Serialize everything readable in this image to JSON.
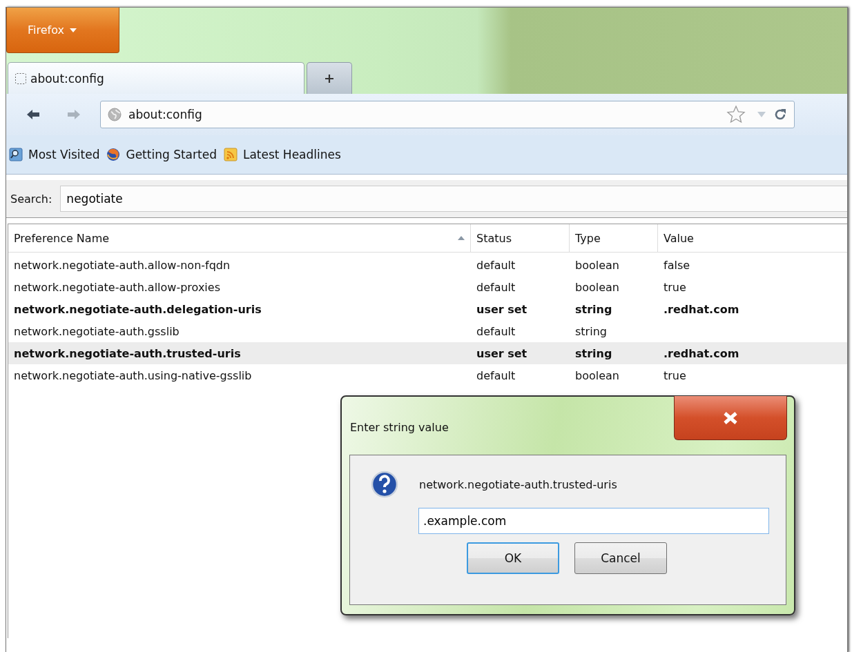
{
  "app_button": {
    "label": "Firefox"
  },
  "tabs": [
    {
      "title": "about:config",
      "selected": true
    }
  ],
  "address_bar": {
    "value": "about:config"
  },
  "bookmarks": [
    {
      "label": "Most Visited",
      "kind": "search"
    },
    {
      "label": "Getting Started",
      "kind": "globe"
    },
    {
      "label": "Latest Headlines",
      "kind": "feed"
    }
  ],
  "search": {
    "label": "Search:",
    "value": "negotiate"
  },
  "table": {
    "columns": [
      {
        "label": "Preference Name",
        "sorted": true
      },
      {
        "label": "Status",
        "sorted": false
      },
      {
        "label": "Type",
        "sorted": false
      },
      {
        "label": "Value",
        "sorted": false
      }
    ],
    "rows": [
      {
        "name": "network.negotiate-auth.allow-non-fqdn",
        "status": "default",
        "type": "boolean",
        "value": "false",
        "modified": false,
        "selected": false
      },
      {
        "name": "network.negotiate-auth.allow-proxies",
        "status": "default",
        "type": "boolean",
        "value": "true",
        "modified": false,
        "selected": false
      },
      {
        "name": "network.negotiate-auth.delegation-uris",
        "status": "user set",
        "type": "string",
        "value": ".redhat.com",
        "modified": true,
        "selected": false
      },
      {
        "name": "network.negotiate-auth.gsslib",
        "status": "default",
        "type": "string",
        "value": "",
        "modified": false,
        "selected": false
      },
      {
        "name": "network.negotiate-auth.trusted-uris",
        "status": "user set",
        "type": "string",
        "value": ".redhat.com",
        "modified": true,
        "selected": true
      },
      {
        "name": "network.negotiate-auth.using-native-gsslib",
        "status": "default",
        "type": "boolean",
        "value": "true",
        "modified": false,
        "selected": false
      }
    ]
  },
  "dialog": {
    "title": "Enter string value",
    "message": "network.negotiate-auth.trusted-uris",
    "value": ".example.com",
    "buttons": [
      {
        "label": "OK",
        "default": true
      },
      {
        "label": "Cancel",
        "default": false
      }
    ]
  }
}
